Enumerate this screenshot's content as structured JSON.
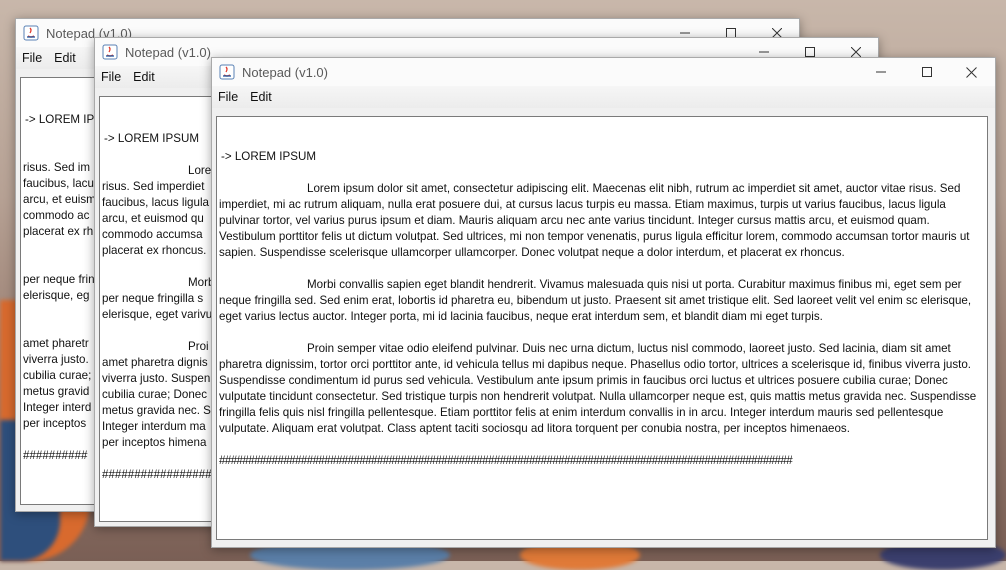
{
  "windows": [
    {
      "title": "Notepad (v1.0)"
    },
    {
      "title": "Notepad (v1.0)"
    },
    {
      "title": "Notepad (v1.0)"
    }
  ],
  "menu": {
    "file": "File",
    "edit": "Edit"
  },
  "document": {
    "heading": "-> LOREM IPSUM",
    "paragraph1": "Lorem ipsum dolor sit amet, consectetur adipiscing elit. Maecenas elit nibh, rutrum ac imperdiet sit amet, auctor vitae risus. Sed imperdiet, mi ac rutrum aliquam, nulla erat posuere dui, at cursus lacus turpis eu massa. Etiam maximus, turpis ut varius faucibus, lacus ligula pulvinar tortor, vel varius purus ipsum et diam. Mauris aliquam arcu nec ante varius tincidunt. Integer cursus mattis arcu, et euismod quam. Vestibulum porttitor felis ut dictum volutpat. Sed ultrices, mi non tempor venenatis, purus ligula efficitur lorem, commodo accumsan tortor mauris ut sapien. Suspendisse scelerisque ullamcorper ullamcorper. Donec volutpat neque a dolor interdum, et placerat ex rhoncus.",
    "paragraph2": "Morbi convallis sapien eget blandit hendrerit. Vivamus malesuada quis nisi ut porta. Curabitur maximus finibus mi, eget sem per neque fringilla sed. Sed enim erat, lobortis id pharetra eu, bibendum ut justo. Praesent sit amet tristique elit. Sed laoreet velit vel enim sc elerisque, eget varius lectus auctor. Integer porta, mi id lacinia faucibus, neque erat interdum sem, et blandit diam mi eget turpis.",
    "paragraph3": "Proin semper vitae odio eleifend pulvinar. Duis nec urna dictum, luctus nisl commodo, laoreet justo. Sed lacinia, diam sit amet pharetra dignissim, tortor orci porttitor ante, id vehicula tellus mi dapibus neque. Phasellus odio tortor, ultrices a scelerisque id, finibus viverra justo. Suspendisse condimentum id purus sed vehicula. Vestibulum ante ipsum primis in faucibus orci luctus et ultrices posuere cubilia curae; Donec vulputate tincidunt consectetur. Sed tristique turpis non hendrerit volutpat. Nulla ullamcorper neque est, quis mattis metus gravida nec. Suspendisse fringilla felis quis nisl fringilla pellentesque. Etiam porttitor felis at enim interdum convallis in in arcu. Integer interdum mauris sed pellentesque vulputate. Aliquam erat volutpat. Class aptent taciti sociosqu ad litora torquent per conubia nostra, per inceptos himenaeos.",
    "hashes": "##################################################################################################"
  },
  "back1": {
    "lines": [
      "-> LOREM IP",
      "risus. Sed im",
      "faucibus, lacu",
      "arcu, et euism",
      "commodo ac",
      "placerat ex rh",
      "per neque frin",
      "elerisque, eg",
      "amet pharetr",
      "viverra justo. ",
      "cubilia curae;",
      "metus gravid",
      "Integer interd",
      " per inceptos",
      "##########"
    ]
  },
  "back2": {
    "lines": [
      "-> LOREM IPSUM",
      "Lore",
      "risus. Sed imperdiet",
      "faucibus, lacus ligula",
      "arcu, et euismod qu",
      "commodo accumsa",
      "placerat ex rhoncus.",
      "Morb",
      "per neque fringilla s",
      "elerisque, eget varivu",
      "Proi",
      "amet pharetra dignis",
      "viverra justo. Suspen",
      "cubilia curae; Donec",
      "metus gravida nec. S",
      "Integer interdum ma",
      " per inceptos himena",
      "##################"
    ]
  }
}
